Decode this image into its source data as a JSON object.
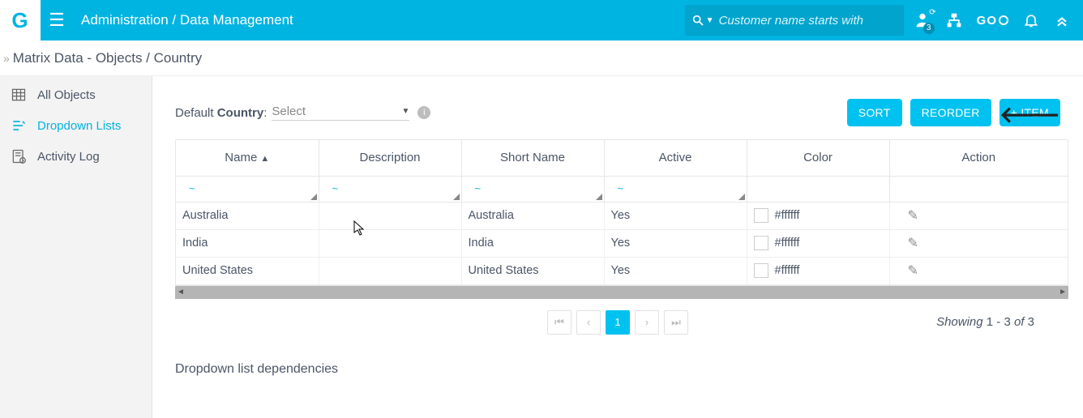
{
  "header": {
    "logo": "G",
    "breadcrumb": "Administration / Data Management",
    "search_placeholder": "Customer name starts with",
    "notification_badge": "3",
    "go_label": "GO"
  },
  "subheader": {
    "title": "Matrix Data - Objects / Country"
  },
  "sidebar": {
    "items": [
      {
        "label": "All Objects"
      },
      {
        "label": "Dropdown Lists"
      },
      {
        "label": "Activity Log"
      }
    ]
  },
  "main": {
    "default_label_prefix": "Default ",
    "default_label_bold": "Country",
    "default_label_suffix": ":",
    "default_select_text": "Select",
    "buttons": {
      "sort": "SORT",
      "reorder": "REORDER",
      "add": "+ ITEM"
    },
    "columns": [
      "Name",
      "Description",
      "Short Name",
      "Active",
      "Color",
      "Action"
    ],
    "filter_marker": "~",
    "rows": [
      {
        "name": "Australia",
        "description": "",
        "short": "Australia",
        "active": "Yes",
        "color": "#ffffff"
      },
      {
        "name": "India",
        "description": "",
        "short": "India",
        "active": "Yes",
        "color": "#ffffff"
      },
      {
        "name": "United States",
        "description": "",
        "short": "United States",
        "active": "Yes",
        "color": "#ffffff"
      }
    ],
    "pager": {
      "current": "1",
      "showing_prefix": "Showing ",
      "showing_range": "1 - 3",
      "showing_of": " of ",
      "showing_total": "3"
    },
    "dependencies_title": "Dropdown list dependencies"
  }
}
